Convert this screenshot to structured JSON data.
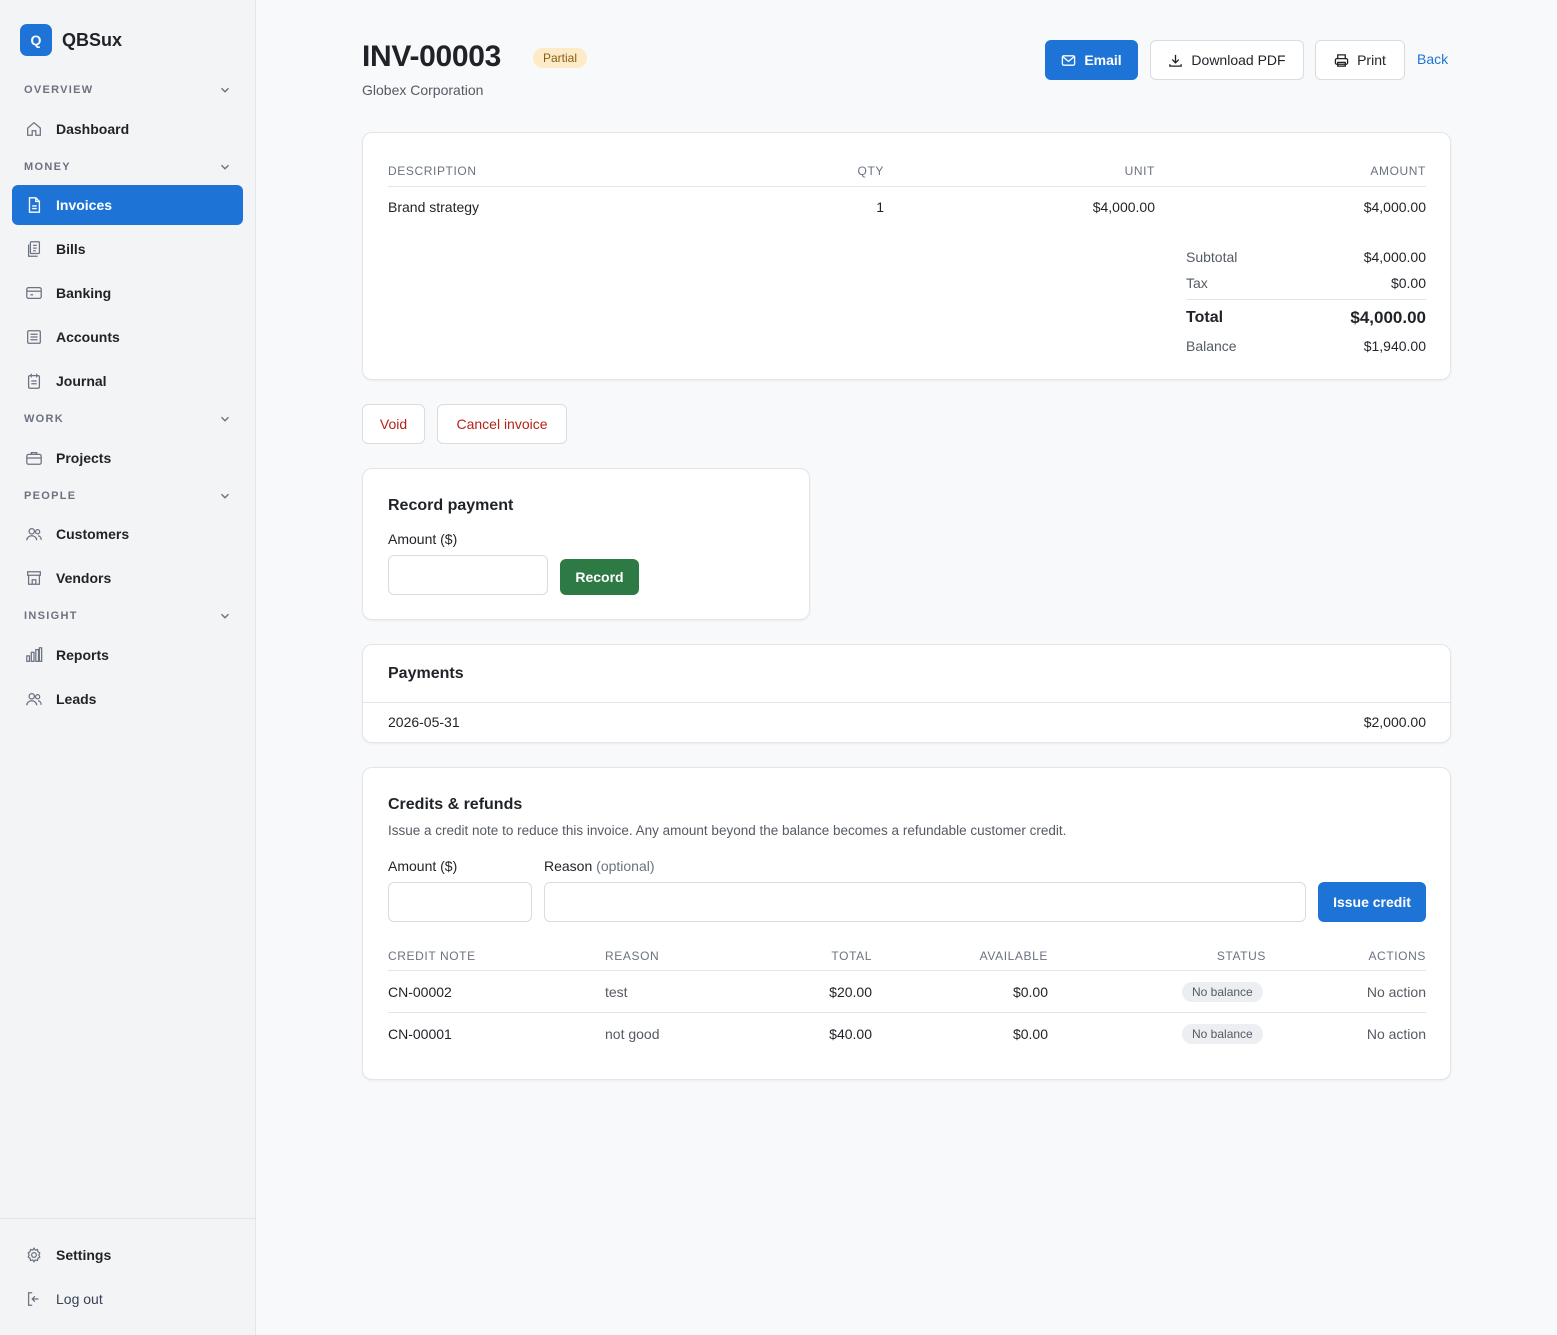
{
  "brand": {
    "logo_letter": "Q",
    "name": "QBSux"
  },
  "sidebar": {
    "sections": [
      {
        "label": "OVERVIEW",
        "items": [
          {
            "label": "Dashboard",
            "icon": "home-icon"
          }
        ]
      },
      {
        "label": "MONEY",
        "items": [
          {
            "label": "Invoices",
            "icon": "document-icon",
            "active": true
          },
          {
            "label": "Bills",
            "icon": "bill-icon"
          },
          {
            "label": "Banking",
            "icon": "bank-icon"
          },
          {
            "label": "Accounts",
            "icon": "ledger-icon"
          },
          {
            "label": "Journal",
            "icon": "journal-icon"
          }
        ]
      },
      {
        "label": "WORK",
        "items": [
          {
            "label": "Projects",
            "icon": "briefcase-icon"
          }
        ]
      },
      {
        "label": "PEOPLE",
        "items": [
          {
            "label": "Customers",
            "icon": "users-icon"
          },
          {
            "label": "Vendors",
            "icon": "store-icon"
          }
        ]
      },
      {
        "label": "INSIGHT",
        "items": [
          {
            "label": "Reports",
            "icon": "bar-chart-icon"
          },
          {
            "label": "Leads",
            "icon": "users-icon"
          }
        ]
      }
    ],
    "footer": [
      {
        "label": "Settings",
        "icon": "gear-icon"
      },
      {
        "label": "Log out",
        "icon": "logout-icon"
      }
    ]
  },
  "header": {
    "invoice_number": "INV-00003",
    "status": "Partial",
    "customer": "Globex Corporation",
    "actions": {
      "email": "Email",
      "download": "Download PDF",
      "print": "Print",
      "back": "Back"
    }
  },
  "line_items": {
    "columns": [
      "DESCRIPTION",
      "QTY",
      "UNIT",
      "AMOUNT"
    ],
    "rows": [
      {
        "description": "Brand strategy",
        "qty": "1",
        "unit": "$4,000.00",
        "amount": "$4,000.00"
      }
    ],
    "totals": {
      "subtotal_label": "Subtotal",
      "subtotal": "$4,000.00",
      "tax_label": "Tax",
      "tax": "$0.00",
      "total_label": "Total",
      "total": "$4,000.00",
      "balance_label": "Balance",
      "balance": "$1,940.00"
    }
  },
  "invoice_actions": {
    "void": "Void",
    "cancel": "Cancel invoice"
  },
  "record_payment": {
    "title": "Record payment",
    "amount_label": "Amount ($)",
    "amount_value": "",
    "button": "Record"
  },
  "payments": {
    "title": "Payments",
    "rows": [
      {
        "date": "2026-05-31",
        "amount": "$2,000.00"
      }
    ]
  },
  "credits": {
    "title": "Credits & refunds",
    "description": "Issue a credit note to reduce this invoice. Any amount beyond the balance becomes a refundable customer credit.",
    "amount_label": "Amount ($)",
    "reason_label": "Reason",
    "reason_optional": "(optional)",
    "amount_value": "",
    "reason_value": "",
    "button": "Issue credit",
    "columns": [
      "CREDIT NOTE",
      "REASON",
      "TOTAL",
      "AVAILABLE",
      "STATUS",
      "ACTIONS"
    ],
    "rows": [
      {
        "note": "CN-00002",
        "reason": "test",
        "total": "$20.00",
        "available": "$0.00",
        "status": "No balance",
        "action": "No action"
      },
      {
        "note": "CN-00001",
        "reason": "not good",
        "total": "$40.00",
        "available": "$0.00",
        "status": "No balance",
        "action": "No action"
      }
    ]
  },
  "colors": {
    "primary": "#1e74d6",
    "success": "#2e7a45",
    "danger": "#b42318",
    "badge_bg": "#fdebc8"
  }
}
